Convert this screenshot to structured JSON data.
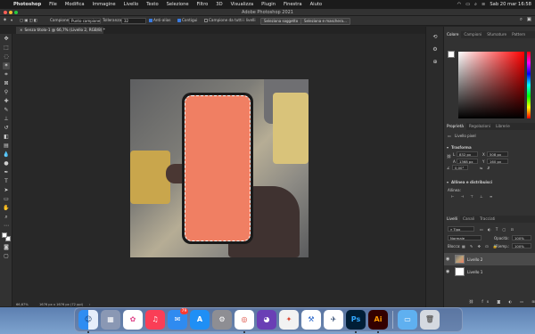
{
  "menubar": {
    "app_name": "Photoshop",
    "items": [
      "File",
      "Modifica",
      "Immagine",
      "Livello",
      "Testo",
      "Selezione",
      "Filtro",
      "3D",
      "Visualizza",
      "Plugin",
      "Finestra",
      "Aiuto"
    ],
    "datetime": "Sab 20 mar  16:58"
  },
  "window": {
    "title": "Adobe Photoshop 2021"
  },
  "options": {
    "sample_label": "Campione:",
    "sample_value": "Punto campione",
    "tolerance_label": "Tolleranza:",
    "tolerance_value": "32",
    "antialias_label": "Anti-alias",
    "contiguous_label": "Contigui",
    "all_layers_label": "Campione da tutti i livelli",
    "select_subject": "Seleziona soggetto",
    "select_mask": "Seleziona e maschera..."
  },
  "document": {
    "tab_title": "Senza titolo-1 @ 66,7% (Livello 2, RGB/8) *",
    "close_glyph": "×"
  },
  "status": {
    "zoom": "66,67%",
    "info": "1676 px x 1676 px (72 ppi)"
  },
  "panels": {
    "color_tabs": [
      "Colore",
      "Campioni",
      "Sfumature",
      "Pattern"
    ],
    "properties_tabs": [
      "Proprietà",
      "Regolazioni",
      "Librerie"
    ],
    "pixel_layer_label": "Livello pixel",
    "transform_header": "Trasforma",
    "transform": {
      "w_label": "L",
      "w_value": "832 px",
      "x_label": "X",
      "x_value": "508 px",
      "h_label": "A",
      "h_value": "1368 px",
      "y_label": "Y",
      "y_value": "160 px",
      "angle_value": "0,00°"
    },
    "align_header": "Allinea e distribuisci",
    "align_label": "Allinea:",
    "layers_tabs": [
      "Livelli",
      "Canali",
      "Tracciati"
    ],
    "kind_filter": "Tipo",
    "blend_mode": "Normale",
    "opacity_label": "Opacità:",
    "opacity_value": "100%",
    "lock_label": "Blocca:",
    "fill_label": "Riemp.:",
    "fill_value": "100%",
    "layers": [
      {
        "name": "Livello 2",
        "selected": true
      },
      {
        "name": "Livello 1",
        "selected": false
      }
    ],
    "footer_icons": [
      "link-icon",
      "fx-icon",
      "mask-icon",
      "adjustment-icon",
      "folder-icon",
      "new-layer-icon",
      "trash-icon"
    ]
  },
  "colors": {
    "phone_fill": "#f07f63",
    "accent": "#3a7be0",
    "panel_bg": "#323232",
    "workspace_bg": "#282828"
  },
  "dock": {
    "apps": [
      "Finder",
      "Launchpad",
      "Foto",
      "Musica",
      "Mail",
      "App Store",
      "Preferenze di Sistema",
      "Chrome",
      "GitHub Desktop",
      "Affinity",
      "Xcode",
      "Dreamweaver",
      "Photoshop",
      "Illustrator",
      "Cartella",
      "Cestino"
    ],
    "mail_badge": "79",
    "ps_label": "Ps",
    "ai_label": "Ai"
  }
}
